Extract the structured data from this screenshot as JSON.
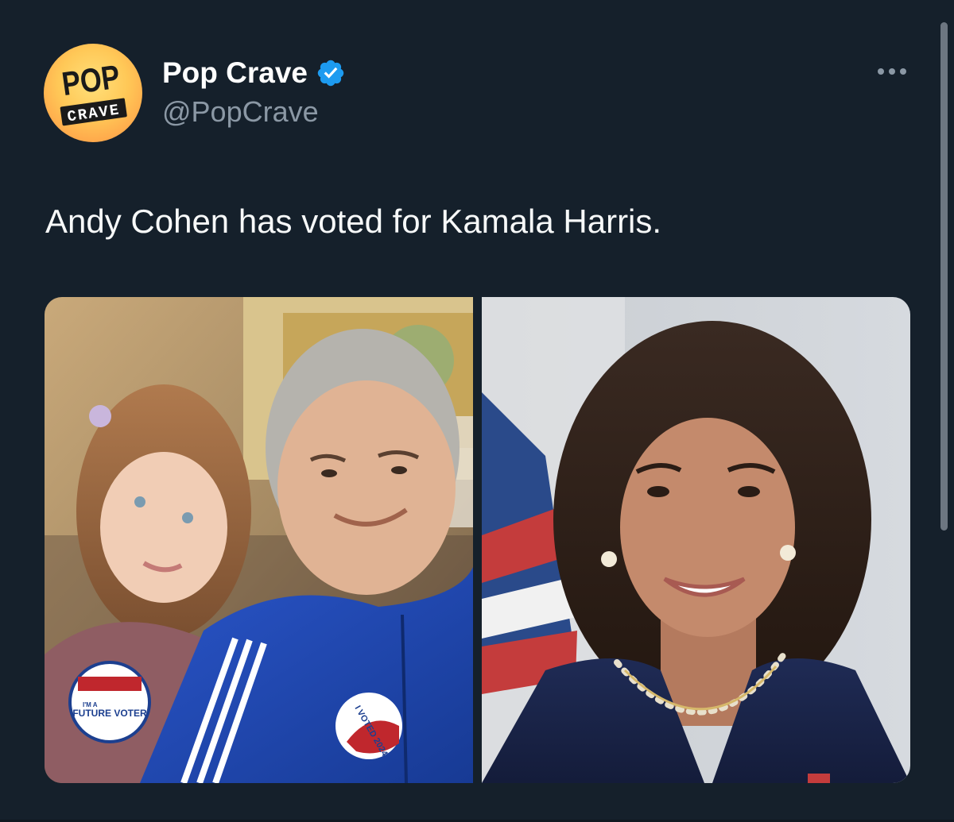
{
  "tweet": {
    "author": {
      "display_name": "Pop Crave",
      "handle": "@PopCrave",
      "verified": true,
      "avatar_logo_top": "POP",
      "avatar_logo_bottom": "CRAVE"
    },
    "text": "Andy Cohen has voted for Kamala Harris.",
    "media": [
      {
        "sticker_child": "FUTURE VOTER",
        "sticker_child_small": "I'M A",
        "sticker_adult": "I VOTED 2024"
      },
      {}
    ],
    "more_icon": "more-horizontal-icon",
    "verified_icon": "verified-badge-icon"
  },
  "colors": {
    "background": "#15202b",
    "text": "#f7f9f9",
    "secondary_text": "#8b98a5",
    "verified": "#1d9bf0",
    "avatar_gradient": [
      "#ffe07a",
      "#ffa54a",
      "#ff8a55"
    ]
  }
}
